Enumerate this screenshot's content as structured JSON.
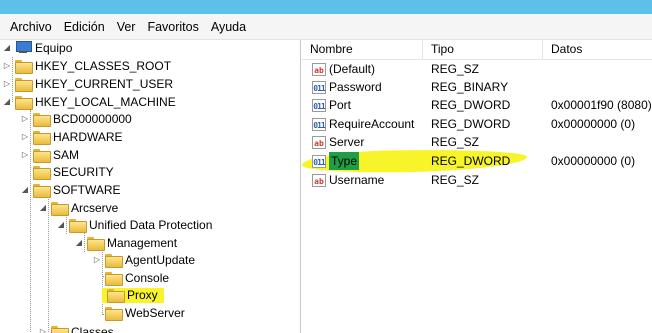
{
  "menu": [
    "Archivo",
    "Edición",
    "Ver",
    "Favoritos",
    "Ayuda"
  ],
  "tree": [
    {
      "label": "Equipo",
      "icon": "computer-icon",
      "expander": "◢"
    },
    {
      "label": "HKEY_CLASSES_ROOT",
      "icon": "folder-icon",
      "expander": "▷"
    },
    {
      "label": "HKEY_CURRENT_USER",
      "icon": "folder-icon",
      "expander": "▷"
    },
    {
      "label": "HKEY_LOCAL_MACHINE",
      "icon": "folder-icon",
      "expander": "◢"
    },
    {
      "label": "BCD00000000",
      "icon": "folder-icon",
      "expander": "▷"
    },
    {
      "label": "HARDWARE",
      "icon": "folder-icon",
      "expander": "▷"
    },
    {
      "label": "SAM",
      "icon": "folder-icon",
      "expander": "▷"
    },
    {
      "label": "SECURITY",
      "icon": "folder-icon",
      "expander": ""
    },
    {
      "label": "SOFTWARE",
      "icon": "folder-icon",
      "expander": "◢"
    },
    {
      "label": "Arcserve",
      "icon": "folder-icon",
      "expander": "◢"
    },
    {
      "label": "Unified Data Protection",
      "icon": "folder-icon",
      "expander": "◢"
    },
    {
      "label": "Management",
      "icon": "folder-icon",
      "expander": "◢"
    },
    {
      "label": "AgentUpdate",
      "icon": "folder-icon",
      "expander": "▷"
    },
    {
      "label": "Console",
      "icon": "folder-icon",
      "expander": ""
    },
    {
      "label": "Proxy",
      "icon": "folder-icon",
      "expander": ""
    },
    {
      "label": "WebServer",
      "icon": "folder-icon",
      "expander": ""
    },
    {
      "label": "Classes",
      "icon": "folder-icon",
      "expander": "▷"
    }
  ],
  "list": {
    "columns": [
      "Nombre",
      "Tipo",
      "Datos"
    ],
    "rows": [
      {
        "name": "(Default)",
        "type": "REG_SZ",
        "data": "",
        "icon": "ab"
      },
      {
        "name": "Password",
        "type": "REG_BINARY",
        "data": "",
        "icon": "011"
      },
      {
        "name": "Port",
        "type": "REG_DWORD",
        "data": "0x00001f90 (8080)",
        "icon": "011"
      },
      {
        "name": "RequireAccount",
        "type": "REG_DWORD",
        "data": "0x00000000 (0)",
        "icon": "011"
      },
      {
        "name": "Server",
        "type": "REG_SZ",
        "data": "",
        "icon": "ab"
      },
      {
        "name": "Type",
        "type": "REG_DWORD",
        "data": "0x00000000 (0)",
        "icon": "011"
      },
      {
        "name": "Username",
        "type": "REG_SZ",
        "data": "",
        "icon": "ab"
      }
    ]
  },
  "colors": {
    "highlight": "#f7f42a",
    "selection": "#1e9f47",
    "title_band": "#5cc0e8"
  }
}
